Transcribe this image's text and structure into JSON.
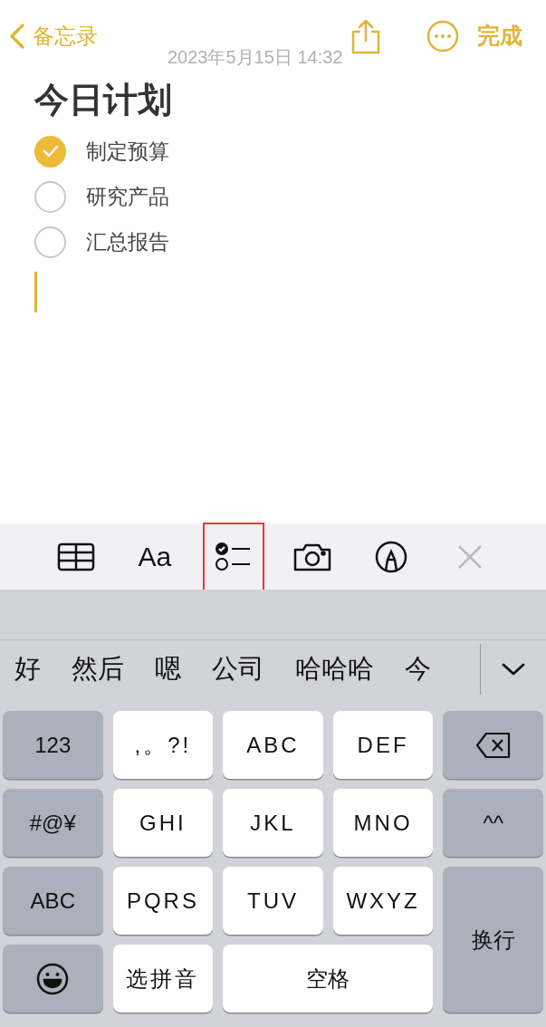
{
  "nav": {
    "back_label": "备忘录",
    "done_label": "完成"
  },
  "note": {
    "date": "2023年5月15日 14:32",
    "title": "今日计划",
    "checklist": [
      {
        "text": "制定预算",
        "checked": true
      },
      {
        "text": "研究产品",
        "checked": false
      },
      {
        "text": "汇总报告",
        "checked": false
      }
    ]
  },
  "toolbar": [
    {
      "kind": "table",
      "highlighted": false,
      "disabled": false
    },
    {
      "kind": "format",
      "label": "Aa",
      "highlighted": false,
      "disabled": false
    },
    {
      "kind": "checklist",
      "highlighted": true,
      "disabled": false
    },
    {
      "kind": "camera",
      "highlighted": false,
      "disabled": false
    },
    {
      "kind": "markup",
      "highlighted": false,
      "disabled": false
    },
    {
      "kind": "close",
      "highlighted": false,
      "disabled": true
    }
  ],
  "candidates": [
    "好",
    "然后",
    "嗯",
    "公司",
    "哈哈哈",
    "今"
  ],
  "keys": [
    {
      "kind": "function",
      "label": "123"
    },
    {
      "kind": "letter",
      "label": ",。?!"
    },
    {
      "kind": "letter",
      "label": "ABC"
    },
    {
      "kind": "letter",
      "label": "DEF"
    },
    {
      "kind": "backspace"
    },
    {
      "kind": "function",
      "label": "#@¥"
    },
    {
      "kind": "letter",
      "label": "GHI"
    },
    {
      "kind": "letter",
      "label": "JKL"
    },
    {
      "kind": "letter",
      "label": "MNO"
    },
    {
      "kind": "function",
      "label": "^^"
    },
    {
      "kind": "function",
      "label": "ABC"
    },
    {
      "kind": "letter",
      "label": "PQRS"
    },
    {
      "kind": "letter",
      "label": "TUV"
    },
    {
      "kind": "letter",
      "label": "WXYZ"
    },
    {
      "kind": "return",
      "label": "换行"
    },
    {
      "kind": "emoji"
    },
    {
      "kind": "letter",
      "label": "选拼音"
    },
    {
      "kind": "space",
      "label": "空格"
    }
  ]
}
